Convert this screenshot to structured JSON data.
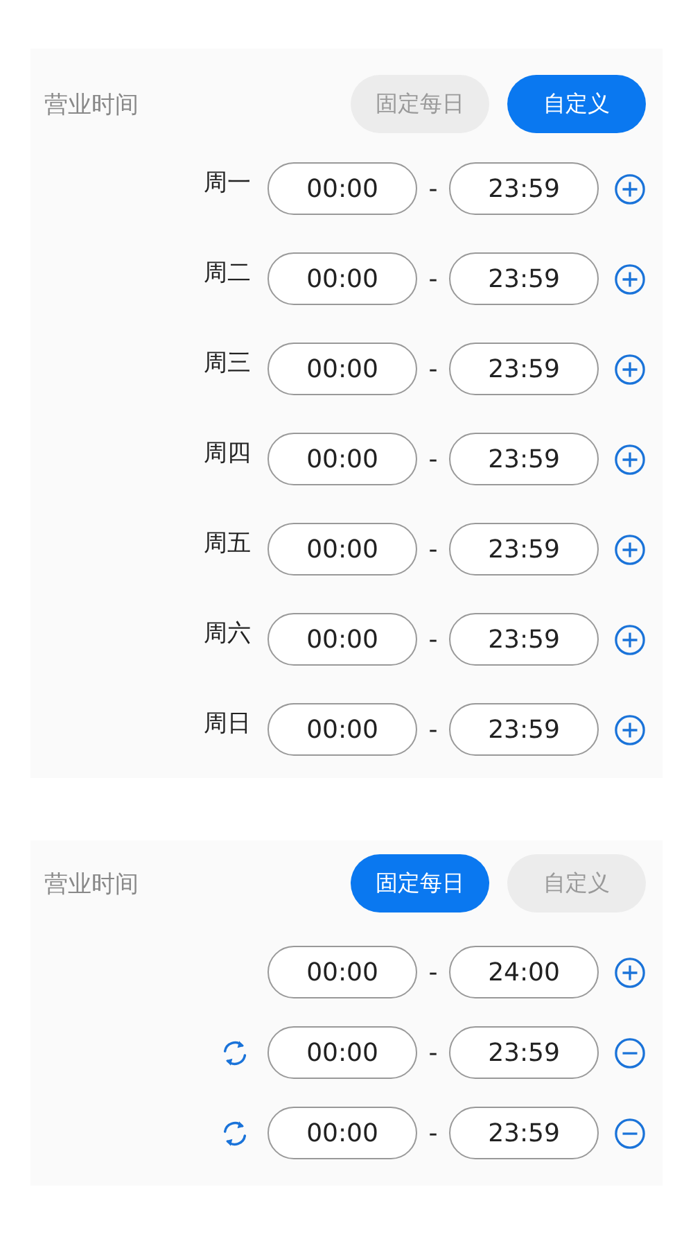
{
  "panels": [
    {
      "title": "营业时间",
      "modes": [
        {
          "label": "固定每日",
          "selected": false
        },
        {
          "label": "自定义",
          "selected": true
        }
      ],
      "rows": [
        {
          "day": "周一",
          "start": "00:00",
          "separator": "-",
          "end": "23:59",
          "kind": "add",
          "reset": false
        },
        {
          "day": "周二",
          "start": "00:00",
          "separator": "-",
          "end": "23:59",
          "kind": "add",
          "reset": false
        },
        {
          "day": "周三",
          "start": "00:00",
          "separator": "-",
          "end": "23:59",
          "kind": "add",
          "reset": false
        },
        {
          "day": "周四",
          "start": "00:00",
          "separator": "-",
          "end": "23:59",
          "kind": "add",
          "reset": false
        },
        {
          "day": "周五",
          "start": "00:00",
          "separator": "-",
          "end": "23:59",
          "kind": "add",
          "reset": false
        },
        {
          "day": "周六",
          "start": "00:00",
          "separator": "-",
          "end": "23:59",
          "kind": "add",
          "reset": false
        },
        {
          "day": "周日",
          "start": "00:00",
          "separator": "-",
          "end": "23:59",
          "kind": "add",
          "reset": false
        }
      ]
    },
    {
      "title": "营业时间",
      "modes": [
        {
          "label": "固定每日",
          "selected": true
        },
        {
          "label": "自定义",
          "selected": false
        }
      ],
      "rows": [
        {
          "start": "00:00",
          "separator": "-",
          "end": "24:00",
          "kind": "add",
          "reset": false
        },
        {
          "start": "00:00",
          "separator": "-",
          "end": "23:59",
          "kind": "remove",
          "reset": true
        },
        {
          "start": "00:00",
          "separator": "-",
          "end": "23:59",
          "kind": "remove",
          "reset": true
        }
      ]
    }
  ]
}
